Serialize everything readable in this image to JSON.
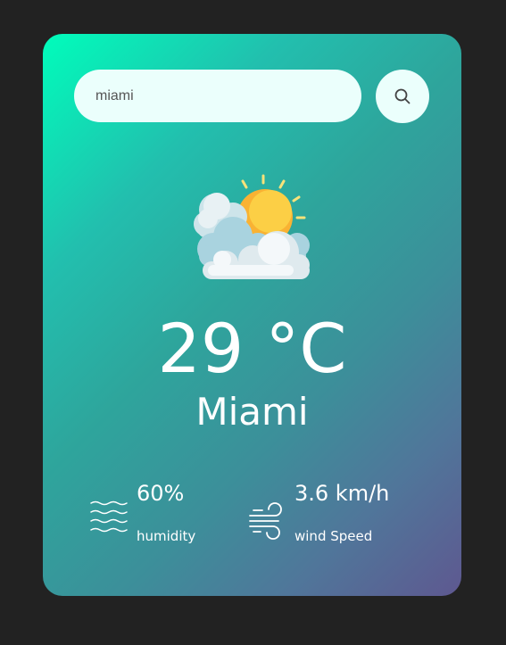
{
  "search": {
    "value": "miami",
    "icon": "search-icon"
  },
  "weather": {
    "icon": "partly-cloudy-icon",
    "temperature": "29 °C",
    "city": "Miami"
  },
  "details": {
    "humidity": {
      "icon": "humidity-icon",
      "value": "60%",
      "label": "humidity"
    },
    "wind": {
      "icon": "wind-icon",
      "value": "3.6 km/h",
      "label": "wind Speed"
    }
  },
  "colors": {
    "background": "#222222",
    "card_gradient_start": "#00fdbb",
    "card_gradient_end": "#5b548e",
    "input_background": "#ebfffc",
    "sun": "#fbc02d",
    "cloud": "#e3eef2"
  }
}
